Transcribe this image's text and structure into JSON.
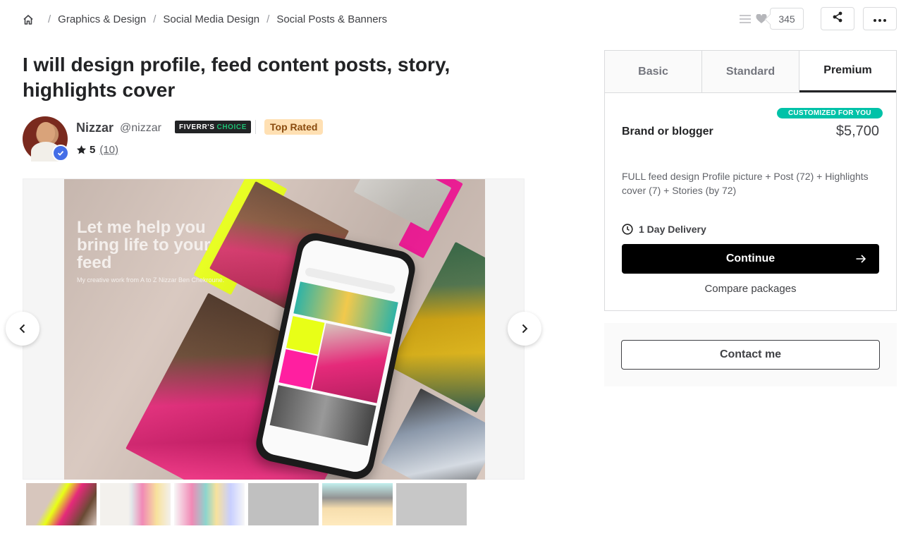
{
  "breadcrumb": {
    "items": [
      "Graphics & Design",
      "Social Media Design",
      "Social Posts & Banners"
    ],
    "separator": "/"
  },
  "actions": {
    "saved_count": "345"
  },
  "gig": {
    "title": "I will design profile, feed content posts, story, highlights cover"
  },
  "seller": {
    "name": "Nizzar",
    "handle": "@nizzar",
    "choice_label_1": "FIVERR'S",
    "choice_label_2": "CHOICE",
    "level_badge": "Top Rated",
    "rating": "5",
    "reviews": "(10)"
  },
  "gallery": {
    "headline": "Let me help you bring life to your feed",
    "subline": "My creative work from A to Z Nizzar Ben Chekroune.",
    "thumbnail_count": 6
  },
  "package": {
    "tabs": [
      "Basic",
      "Standard",
      "Premium"
    ],
    "selected_tab": "Premium",
    "tag": "CUSTOMIZED FOR YOU",
    "name": "Brand or blogger",
    "price": "$5,700",
    "description": "FULL feed design Profile picture + Post (72) + Highlights cover (7) + Stories (by 72)",
    "delivery": "1 Day Delivery",
    "continue_label": "Continue",
    "compare_label": "Compare packages"
  },
  "contact": {
    "label": "Contact me"
  },
  "colors": {
    "accent": "#1dbf73",
    "tag_bg": "#00c2a8",
    "top_rated_bg": "#ffe0b3",
    "verified": "#446ee7"
  }
}
